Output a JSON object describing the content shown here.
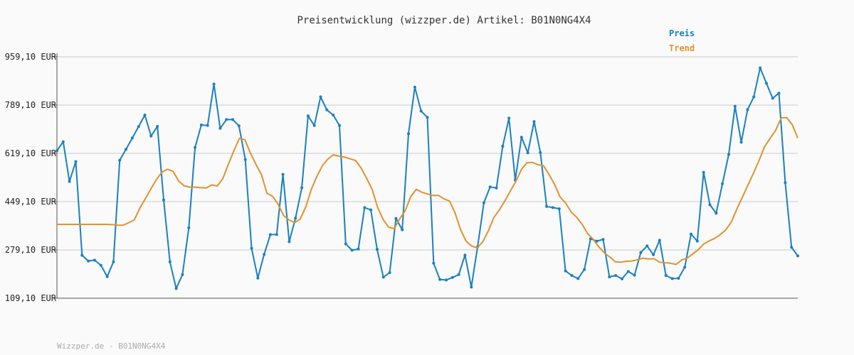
{
  "chart_data": {
    "type": "line",
    "title": "Preisentwicklung (wizzper.de) Artikel: B01N0NG4X4",
    "footer": "Wizzper.de - B01N0NG4X4",
    "ylim": [
      109.1,
      959.1
    ],
    "y_ticks": [
      "959,10 EUR",
      "789,10 EUR",
      "619,10 EUR",
      "449,10 EUR",
      "279,10 EUR",
      "109,10 EUR"
    ],
    "y_tick_values": [
      959.1,
      789.1,
      619.1,
      449.1,
      279.1,
      109.1
    ],
    "grid": true,
    "legend_position": "top-right",
    "colors": {
      "preis": "#1a80c0",
      "trend": "#e0922e"
    },
    "series": [
      {
        "name": "Preis",
        "values": [
          628,
          660,
          520,
          590,
          260,
          240,
          243,
          225,
          185,
          237,
          595,
          633,
          673,
          713,
          754,
          680,
          714,
          455,
          237,
          143,
          192,
          357,
          640,
          719,
          717,
          863,
          707,
          738,
          738,
          716,
          597,
          285,
          180,
          263,
          333,
          333,
          545,
          308,
          391,
          498,
          751,
          717,
          818,
          772,
          754,
          717,
          300,
          278,
          282,
          428,
          420,
          281,
          183,
          199,
          390,
          350,
          688,
          852,
          768,
          746,
          232,
          175,
          173,
          182,
          192,
          261,
          148,
          290,
          445,
          501,
          497,
          644,
          743,
          525,
          676,
          621,
          731,
          622,
          432,
          428,
          424,
          205,
          189,
          178,
          210,
          318,
          310,
          316,
          184,
          189,
          177,
          203,
          190,
          270,
          293,
          262,
          313,
          189,
          178,
          179,
          218,
          335,
          310,
          552,
          438,
          408,
          512,
          615,
          785,
          658,
          773,
          818,
          920,
          866,
          813,
          831,
          516,
          288,
          258
        ]
      },
      {
        "name": "Trend",
        "values": [
          369,
          369,
          369,
          369,
          369,
          369,
          369,
          369,
          369,
          369,
          368,
          366,
          366,
          375,
          385,
          426,
          460,
          494,
          527,
          553,
          563,
          556,
          522,
          505,
          500,
          500,
          498,
          497,
          508,
          504,
          530,
          580,
          628,
          672,
          667,
          620,
          580,
          544,
          478,
          468,
          440,
          400,
          384,
          375,
          388,
          430,
          492,
          537,
          575,
          599,
          614,
          609,
          606,
          600,
          594,
          568,
          532,
          493,
          429,
          386,
          359,
          354,
          389,
          417,
          467,
          492,
          482,
          476,
          471,
          471,
          459,
          451,
          410,
          351,
          310,
          293,
          286,
          307,
          345,
          392,
          419,
          451,
          486,
          520,
          562,
          586,
          587,
          579,
          576,
          545,
          510,
          466,
          444,
          413,
          394,
          369,
          336,
          316,
          290,
          269,
          254,
          237,
          236,
          239,
          240,
          244,
          250,
          247,
          248,
          236,
          234,
          232,
          228,
          244,
          250,
          265,
          280,
          300,
          311,
          320,
          333,
          350,
          378,
          424,
          465,
          508,
          550,
          594,
          643,
          672,
          700,
          744,
          745,
          720,
          673
        ]
      }
    ]
  }
}
